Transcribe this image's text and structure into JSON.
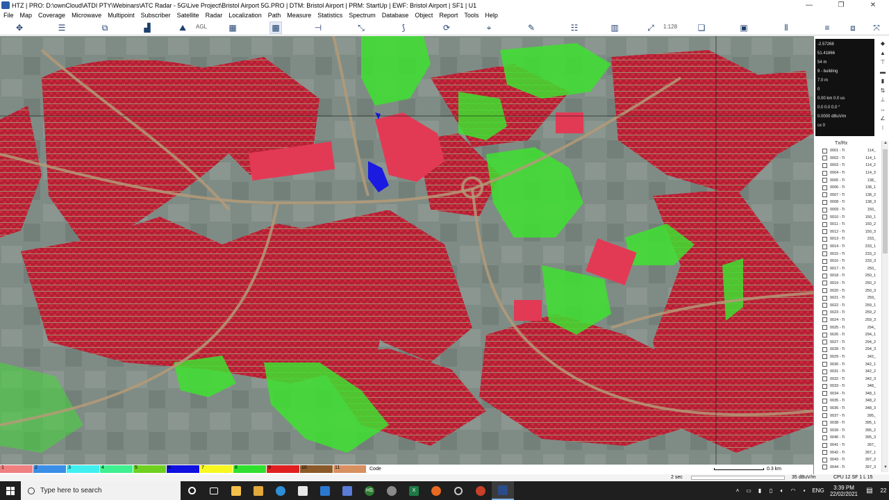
{
  "window": {
    "title": "HTZ | PRO: D:\\ownCloud\\ATDI PTY\\Webinars\\ATC Radar - 5G\\Live Project\\Bristol Airport 5G.PRO | DTM: Bristol Airport | PRM: StartUp | EWF: Bristol Airport | SF1 | U1",
    "minimize": "—",
    "restore": "❐",
    "close": "✕"
  },
  "menu": [
    "File",
    "Map",
    "Coverage",
    "Microwave",
    "Multipoint",
    "Subscriber",
    "Satellite",
    "Radar",
    "Localization",
    "Path",
    "Measure",
    "Statistics",
    "Spectrum",
    "Database",
    "Object",
    "Report",
    "Tools",
    "Help"
  ],
  "toolbar": {
    "agl_label": "AGL",
    "scale_label": "1:128"
  },
  "info_panel": {
    "lines": [
      "-2.57268",
      "51.41866",
      "54 m",
      "9 - building",
      "7.0 m",
      "0",
      "0.00 km 0.0 us",
      "0.0 0.0 0.0 °",
      "0.0000 dBuV/m",
      "cx 0"
    ]
  },
  "txrx": {
    "header": "Tx/Rx",
    "rows": [
      {
        "name": "0001 - Ti",
        "value": "114_"
      },
      {
        "name": "0002 - Ti",
        "value": "114_1"
      },
      {
        "name": "0003 - Ti",
        "value": "114_2"
      },
      {
        "name": "0004 - Ti",
        "value": "114_3"
      },
      {
        "name": "0005 - Ti",
        "value": "138_"
      },
      {
        "name": "0006 - Ti",
        "value": "138_1"
      },
      {
        "name": "0007 - Ti",
        "value": "138_2"
      },
      {
        "name": "0008 - Ti",
        "value": "138_3"
      },
      {
        "name": "0009 - Ti",
        "value": "150_"
      },
      {
        "name": "0010 - Ti",
        "value": "150_1"
      },
      {
        "name": "0011 - Ti",
        "value": "150_2"
      },
      {
        "name": "0012 - Ti",
        "value": "150_3"
      },
      {
        "name": "0013 - Ti",
        "value": "233_"
      },
      {
        "name": "0014 - Ti",
        "value": "233_1"
      },
      {
        "name": "0015 - Ti",
        "value": "233_2"
      },
      {
        "name": "0016 - Ti",
        "value": "233_3"
      },
      {
        "name": "0017 - Ti",
        "value": "250_"
      },
      {
        "name": "0018 - Ti",
        "value": "250_1"
      },
      {
        "name": "0019 - Ti",
        "value": "250_2"
      },
      {
        "name": "0020 - Ti",
        "value": "250_3"
      },
      {
        "name": "0021 - Ti",
        "value": "259_"
      },
      {
        "name": "0022 - Ti",
        "value": "259_1"
      },
      {
        "name": "0023 - Ti",
        "value": "259_2"
      },
      {
        "name": "0024 - Ti",
        "value": "259_3"
      },
      {
        "name": "0025 - Ti",
        "value": "294_"
      },
      {
        "name": "0026 - Ti",
        "value": "294_1"
      },
      {
        "name": "0027 - Ti",
        "value": "294_2"
      },
      {
        "name": "0028 - Ti",
        "value": "294_3"
      },
      {
        "name": "0029 - Ti",
        "value": "342_"
      },
      {
        "name": "0030 - Ti",
        "value": "342_1"
      },
      {
        "name": "0031 - Ti",
        "value": "342_2"
      },
      {
        "name": "0032 - Ti",
        "value": "342_3"
      },
      {
        "name": "0033 - Ti",
        "value": "348_"
      },
      {
        "name": "0034 - Ti",
        "value": "348_1"
      },
      {
        "name": "0035 - Ti",
        "value": "348_2"
      },
      {
        "name": "0036 - Ti",
        "value": "348_3"
      },
      {
        "name": "0037 - Ti",
        "value": "395_"
      },
      {
        "name": "0038 - Ti",
        "value": "395_1"
      },
      {
        "name": "0039 - Ti",
        "value": "395_2"
      },
      {
        "name": "0040 - Ti",
        "value": "395_3"
      },
      {
        "name": "0041 - Ti",
        "value": "397_"
      },
      {
        "name": "0042 - Ti",
        "value": "397_1"
      },
      {
        "name": "0043 - Ti",
        "value": "397_2"
      },
      {
        "name": "0044 - Ti",
        "value": "397_3"
      }
    ]
  },
  "legend": {
    "items": [
      {
        "num": "1",
        "color": "#f08080"
      },
      {
        "num": "2",
        "color": "#3a8ee8"
      },
      {
        "num": "3",
        "color": "#40f0f0"
      },
      {
        "num": "4",
        "color": "#40f090"
      },
      {
        "num": "5",
        "color": "#70d020"
      },
      {
        "num": "6",
        "color": "#1010e0"
      },
      {
        "num": "7",
        "color": "#f8f820"
      },
      {
        "num": "8",
        "color": "#30e030"
      },
      {
        "num": "9",
        "color": "#e02020"
      },
      {
        "num": "10",
        "color": "#8a5a2a"
      },
      {
        "num": "11",
        "color": "#d89060"
      }
    ],
    "code_label": "Code",
    "scale_text": "0.3 km"
  },
  "statusbar": {
    "time": "2 sec",
    "field": "35 dBuV/m",
    "cpu": "CPU 12  SF 1  L 15"
  },
  "taskbar": {
    "search_placeholder": "Type here to search",
    "lang": "ENG",
    "time": "3:39 PM",
    "date": "22/02/2021",
    "notif_count": "22"
  },
  "colors": {
    "building": "#c8243a",
    "coverage": "#3ee030",
    "terrain": "#7d8a83",
    "road": "#b49a78"
  }
}
